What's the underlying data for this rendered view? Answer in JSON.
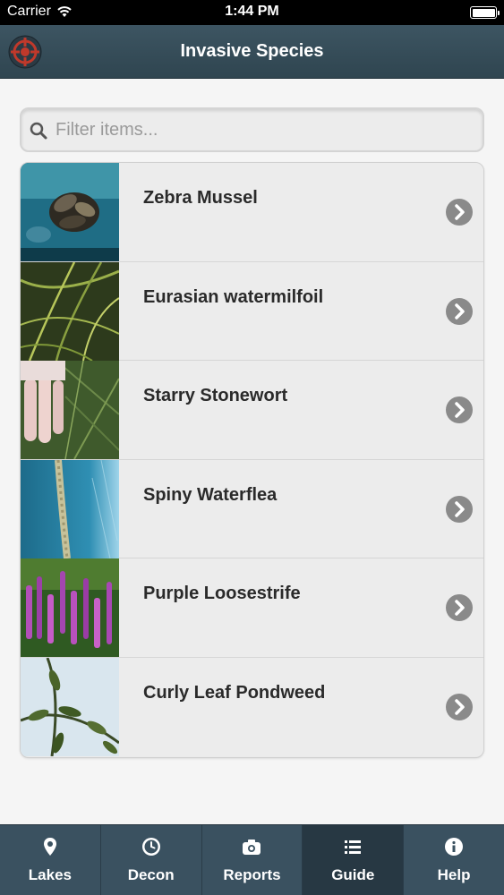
{
  "status_bar": {
    "carrier": "Carrier",
    "time": "1:44 PM"
  },
  "header": {
    "title": "Invasive Species"
  },
  "search": {
    "placeholder": "Filter items..."
  },
  "items": [
    {
      "label": "Zebra Mussel"
    },
    {
      "label": "Eurasian watermilfoil"
    },
    {
      "label": "Starry Stonewort"
    },
    {
      "label": "Spiny Waterflea"
    },
    {
      "label": "Purple Loosestrife"
    },
    {
      "label": "Curly Leaf Pondweed"
    }
  ],
  "tabs": [
    {
      "label": "Lakes",
      "icon": "map-pin-icon"
    },
    {
      "label": "Decon",
      "icon": "clock-icon"
    },
    {
      "label": "Reports",
      "icon": "camera-icon"
    },
    {
      "label": "Guide",
      "icon": "list-icon",
      "active": true
    },
    {
      "label": "Help",
      "icon": "info-icon"
    }
  ],
  "colors": {
    "nav": "#34495a",
    "tab_bar": "#3a5160",
    "active_tab": "#273843",
    "chevron": "#8a8a8a"
  }
}
